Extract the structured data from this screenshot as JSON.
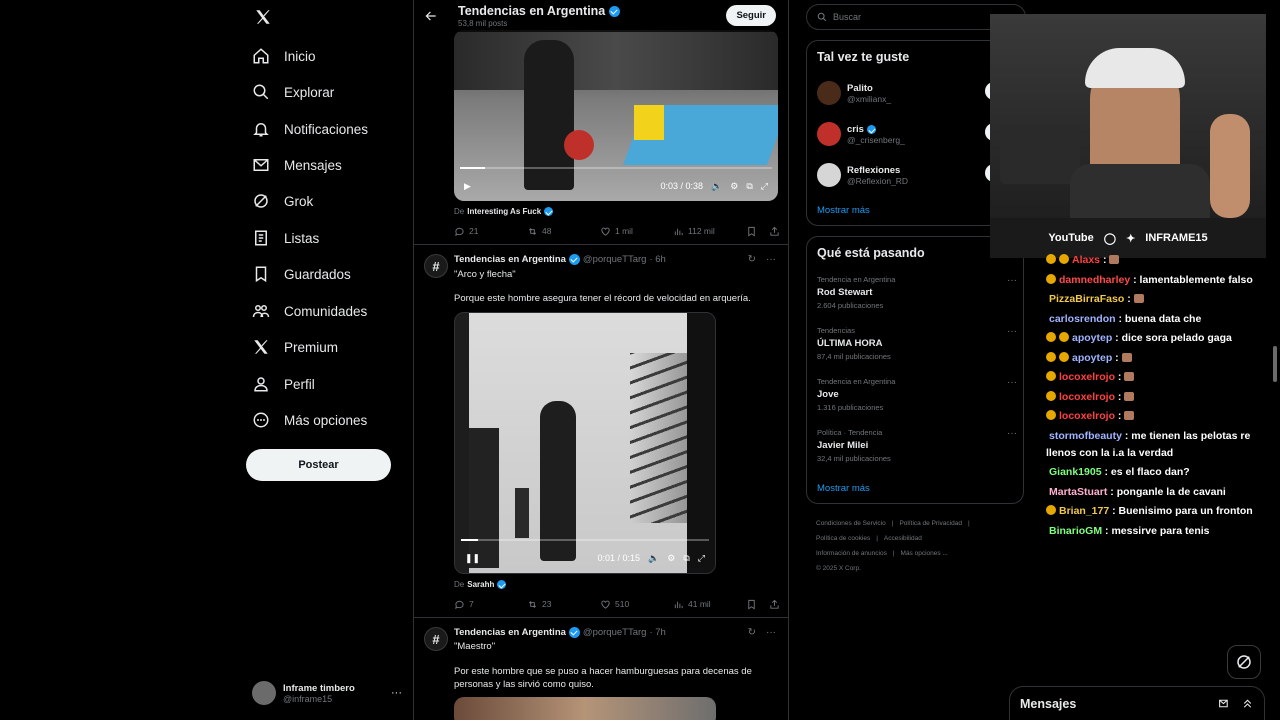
{
  "nav": {
    "items": [
      {
        "label": "Inicio",
        "icon": "home-icon"
      },
      {
        "label": "Explorar",
        "icon": "search-icon"
      },
      {
        "label": "Notificaciones",
        "icon": "bell-icon"
      },
      {
        "label": "Mensajes",
        "icon": "mail-icon"
      },
      {
        "label": "Grok",
        "icon": "grok-icon"
      },
      {
        "label": "Listas",
        "icon": "list-icon"
      },
      {
        "label": "Guardados",
        "icon": "bookmark-icon"
      },
      {
        "label": "Comunidades",
        "icon": "communities-icon"
      },
      {
        "label": "Premium",
        "icon": "x-logo-icon"
      },
      {
        "label": "Perfil",
        "icon": "person-icon"
      },
      {
        "label": "Más opciones",
        "icon": "more-circle-icon"
      }
    ],
    "post_button": "Postear",
    "profile": {
      "name": "Inframe timbero",
      "handle": "@inframe15"
    }
  },
  "feed": {
    "header": {
      "title": "Tendencias en Argentina",
      "subtitle": "53,8 mil posts",
      "follow": "Seguir"
    },
    "tweets": [
      {
        "video": {
          "time": "0:03 / 0:38",
          "progress": 0.08
        },
        "source_prefix": "De",
        "source": "Interesting As Fuck",
        "stats": {
          "replies": "21",
          "reposts": "48",
          "likes": "1 mil",
          "views": "112 mil"
        }
      },
      {
        "author": "Tendencias en Argentina",
        "handle": "@porqueTTarg",
        "time": "· 6h",
        "quote": "\"Arco y flecha\"",
        "text": "Porque este hombre asegura tener el récord de velocidad en arquería.",
        "video": {
          "time": "0:01 / 0:15",
          "progress": 0.07
        },
        "source_prefix": "De",
        "source": "Sarahh",
        "stats": {
          "replies": "7",
          "reposts": "23",
          "likes": "510",
          "views": "41 mil"
        }
      },
      {
        "author": "Tendencias en Argentina",
        "handle": "@porqueTTarg",
        "time": "· 7h",
        "quote": "\"Maestro\"",
        "text": "Por este hombre que se puso a hacer hamburguesas para decenas de personas y las sirvió como quiso."
      }
    ]
  },
  "sidebar": {
    "search_placeholder": "Buscar",
    "suggestions": {
      "title": "Tal vez te guste",
      "people": [
        {
          "name": "Palito",
          "handle": "@xmilianx_",
          "button": "Seguir",
          "verified": false,
          "color": "#4a2b1a"
        },
        {
          "name": "cris",
          "handle": "@_crisenberg_",
          "button": "Seguir",
          "verified": true,
          "color": "#c0302a"
        },
        {
          "name": "Reflexiones",
          "handle": "@Reflexion_RD",
          "button": "Seguir",
          "verified": false,
          "color": "#d6d6d6"
        }
      ],
      "more": "Mostrar más"
    },
    "trends": {
      "title": "Qué está pasando",
      "items": [
        {
          "context": "Tendencia en Argentina",
          "name": "Rod Stewart",
          "count": "2.604 publicaciones"
        },
        {
          "context": "Tendencias",
          "name": "ÚLTIMA HORA",
          "count": "87,4 mil publicaciones"
        },
        {
          "context": "Tendencia en Argentina",
          "name": "Jove",
          "count": "1.316 publicaciones"
        },
        {
          "context": "Política · Tendencia",
          "name": "Javier Milei",
          "count": "32,4 mil publicaciones"
        }
      ],
      "more": "Mostrar más"
    },
    "footer": {
      "links": [
        "Condiciones de Servicio",
        "|",
        "Política de Privacidad",
        "|",
        "Política de cookies",
        "|",
        "Accesibilidad",
        "Información de anuncios",
        "|",
        "Más opciones ...",
        "© 2025 X Corp."
      ]
    }
  },
  "overlay": {
    "brand": {
      "youtube": "YouTube",
      "name": "INFRAME15"
    },
    "chat": [
      {
        "user": "Alaxs",
        "color": "#ff4040",
        "text": "",
        "badges": 2
      },
      {
        "user": "damnedharley",
        "color": "#ff4848",
        "text": "lamentablemente falso",
        "badges": 1
      },
      {
        "user": "PizzaBirraFaso",
        "color": "#f2c94c",
        "text": "",
        "badges": 0
      },
      {
        "user": "carlosrendon",
        "color": "#a0b4ff",
        "text": "buena data che",
        "badges": 0
      },
      {
        "user": "apoytep",
        "color": "#a0b4ff",
        "text": "dice sora pelado gaga",
        "badges": 2
      },
      {
        "user": "apoytep",
        "color": "#a0b4ff",
        "text": "",
        "badges": 2
      },
      {
        "user": "locoxelrojo",
        "color": "#ff4040",
        "text": "",
        "badges": 1
      },
      {
        "user": "locoxelrojo",
        "color": "#ff4040",
        "text": "",
        "badges": 1
      },
      {
        "user": "locoxelrojo",
        "color": "#ff4040",
        "text": "",
        "badges": 1
      },
      {
        "user": "stormofbeauty",
        "color": "#a0b4ff",
        "text": "me tienen las pelotas re llenos con la i.a la verdad",
        "badges": 0
      },
      {
        "user": "Giank1905",
        "color": "#7fff7f",
        "text": "es el flaco dan?",
        "badges": 0
      },
      {
        "user": "MartaStuart",
        "color": "#ffb0d0",
        "text": "ponganle la de cavani",
        "badges": 0
      },
      {
        "user": "Brian_177",
        "color": "#f2c94c",
        "text": "Buenisimo para un fronton",
        "badges": 1
      },
      {
        "user": "BinarioGM",
        "color": "#7fff7f",
        "text": "messirve para tenis",
        "badges": 0
      }
    ]
  },
  "messages_drawer": {
    "label": "Mensajes"
  },
  "colors": {
    "accent": "#1d9bf0",
    "bg": "#000000",
    "border": "#2f3336",
    "muted": "#71767b"
  }
}
